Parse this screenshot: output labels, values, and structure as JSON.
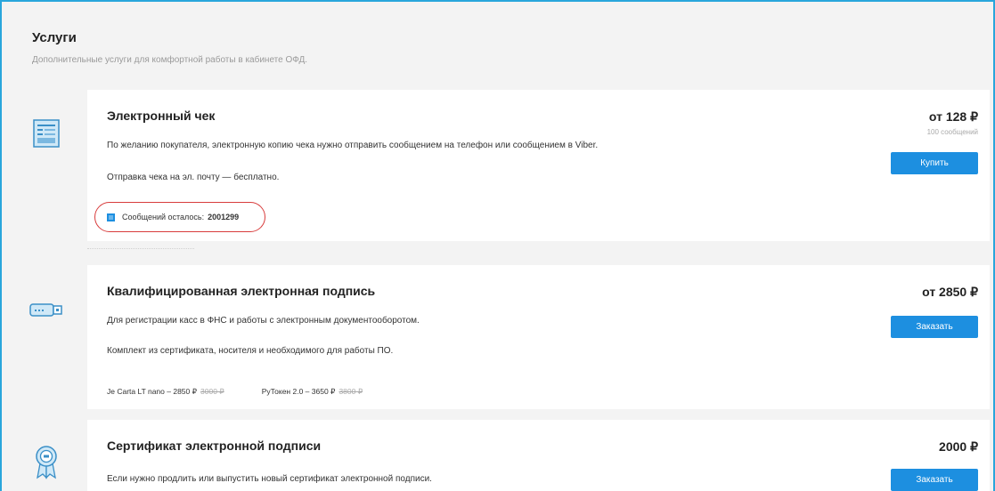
{
  "header": {
    "title": "Услуги",
    "subtitle": "Дополнительные услуги для комфортной работы в кабинете ОФД."
  },
  "services": [
    {
      "title": "Электронный чек",
      "text1": "По желанию покупателя, электронную копию чека нужно отправить сообщением на телефон или сообщением в Viber.",
      "text2": "Отправка чека на эл. почту — бесплатно.",
      "price": "от 128 ₽",
      "price_note": "100 сообщений",
      "button": "Купить",
      "remaining_label": "Сообщений осталось:",
      "remaining_value": "2001299"
    },
    {
      "title": "Квалифицированная электронная подпись",
      "text1": "Для регистрации касс в ФНС и работы с электронным документооборотом.",
      "text2": "Комплект из сертификата, носителя и необходимого для работы ПО.",
      "price": "от 2850 ₽",
      "button": "Заказать",
      "tokens": [
        {
          "label": "Je Carta LT nano – 2850 ₽",
          "old": "3000 ₽"
        },
        {
          "label": "РуТокен 2.0 – 3650 ₽",
          "old": "3800 ₽"
        }
      ]
    },
    {
      "title": "Сертификат электронной подписи",
      "text1": "Если нужно продлить или выпустить новый сертификат электронной подписи.",
      "price": "2000 ₽",
      "button": "Заказать"
    }
  ],
  "icons": [
    "receipt-icon",
    "usb-token-icon",
    "certificate-badge-icon"
  ],
  "colors": {
    "accent": "#1d8fe0",
    "frame": "#29a6dc",
    "highlight": "#d83c3c"
  }
}
